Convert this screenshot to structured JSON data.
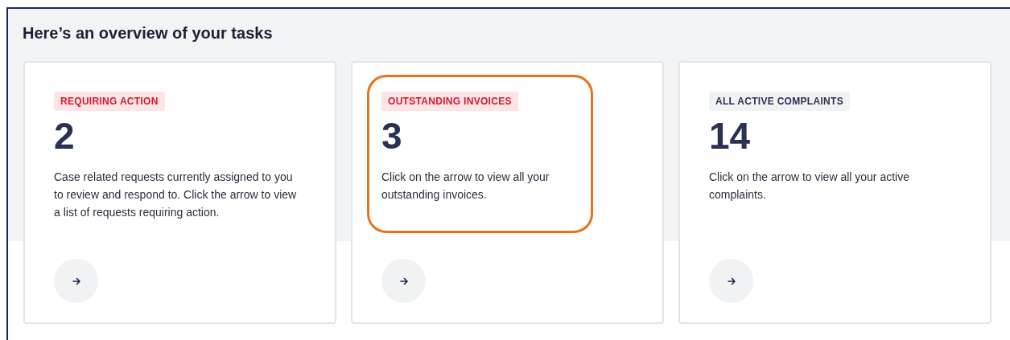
{
  "heading": "Here’s an overview of your tasks",
  "cards": [
    {
      "tag": "REQUIRING ACTION",
      "kind": "alert",
      "count": "2",
      "description": "Case related requests currently assigned to you to review and respond to. Click the arrow to view a list of requests requiring action.",
      "highlighted": false
    },
    {
      "tag": "OUTSTANDING INVOICES",
      "kind": "alert",
      "count": "3",
      "description": "Click on the arrow to view all your outstanding invoices.",
      "highlighted": true
    },
    {
      "tag": "ALL ACTIVE COMPLAINTS",
      "kind": "neutral",
      "count": "14",
      "description": "Click on the arrow to view all your active complaints.",
      "highlighted": false
    }
  ]
}
